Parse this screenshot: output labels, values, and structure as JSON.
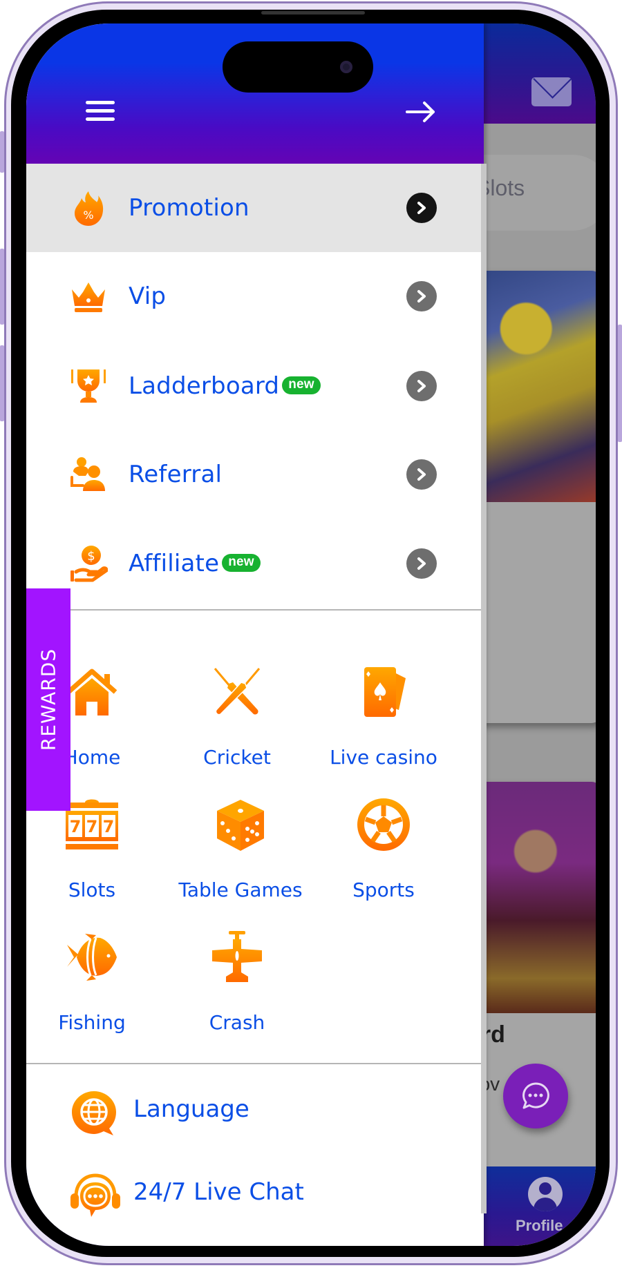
{
  "drawer": {
    "header": {
      "menu_icon": "hamburger-icon",
      "close_icon": "arrow-right-icon"
    },
    "menu_items": [
      {
        "label": "Promotion",
        "icon": "flame-percent-icon",
        "badge": null,
        "active": true
      },
      {
        "label": "Vip",
        "icon": "crown-icon",
        "badge": null,
        "active": false
      },
      {
        "label": "Ladderboard",
        "icon": "trophy-icon",
        "badge": "new",
        "active": false
      },
      {
        "label": "Referral",
        "icon": "people-icon",
        "badge": null,
        "active": false
      },
      {
        "label": "Affiliate",
        "icon": "hand-coin-icon",
        "badge": "new",
        "active": false
      }
    ],
    "rewards_tab": "REWARDS",
    "categories": [
      {
        "label": "Home",
        "icon": "home-icon"
      },
      {
        "label": "Cricket",
        "icon": "cricket-bats-icon"
      },
      {
        "label": "Live casino",
        "icon": "playing-cards-icon"
      },
      {
        "label": "Slots",
        "icon": "slot-machine-icon"
      },
      {
        "label": "Table Games",
        "icon": "dice-icon"
      },
      {
        "label": "Sports",
        "icon": "soccer-ball-icon"
      },
      {
        "label": "Fishing",
        "icon": "fish-icon"
      },
      {
        "label": "Crash",
        "icon": "airplane-icon"
      }
    ],
    "footer_items": [
      {
        "label": "Language",
        "icon": "globe-chat-icon"
      },
      {
        "label": "24/7 Live Chat",
        "icon": "headset-chat-icon"
      }
    ]
  },
  "background": {
    "category_pill": "Slots",
    "card_title_fragment": "ard",
    "card_sub_fragment": "nov",
    "bottom_nav_profile": "Profile"
  },
  "colors": {
    "accent_text": "#0a4ee6",
    "icon_orange": "#ff8a00",
    "badge_green": "#17b230",
    "rewards_purple": "#a214ff",
    "header_top": "#0a36e6",
    "header_bottom": "#6404b4"
  }
}
